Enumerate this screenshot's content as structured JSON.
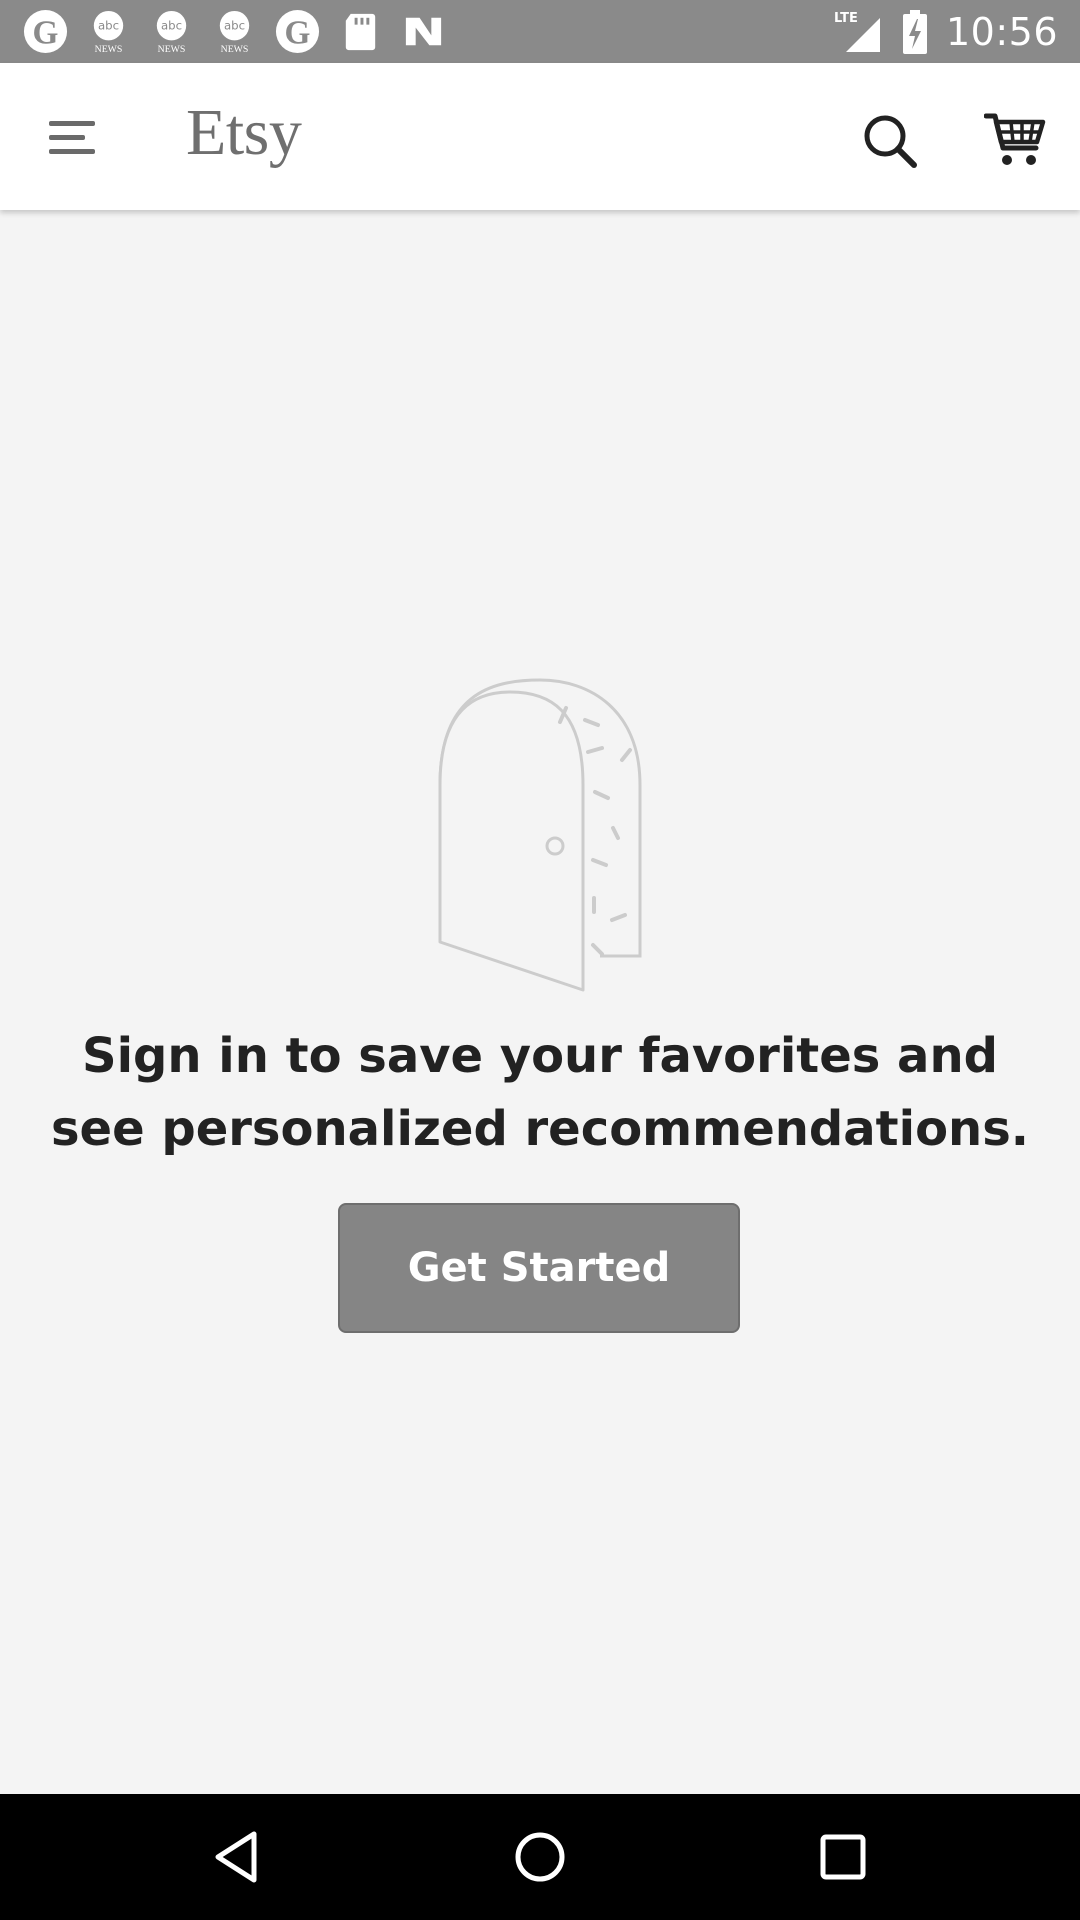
{
  "status_bar": {
    "time": "10:56",
    "network_label": "LTE",
    "notification_icons": [
      "g-icon",
      "abc-news-icon",
      "abc-news-icon",
      "abc-news-icon",
      "g-icon",
      "sd-card-icon",
      "n-icon"
    ],
    "abc_logo_text": "abc",
    "abc_news_text": "NEWS"
  },
  "app_bar": {
    "brand": "Etsy",
    "icons": [
      "menu-icon",
      "search-icon",
      "cart-icon"
    ]
  },
  "empty_state": {
    "illustration": "open-door-icon",
    "message": "Sign in to save your favorites and see personalized recommendations.",
    "button_label": "Get Started"
  },
  "nav_bar": {
    "icons": [
      "back-icon",
      "home-icon",
      "recents-icon"
    ]
  },
  "colors": {
    "status_bar": "#8a8a8a",
    "app_bar": "#ffffff",
    "background": "#f4f4f4",
    "button": "#858585",
    "brand_text": "#6f6f6f",
    "nav_bar": "#000000"
  }
}
